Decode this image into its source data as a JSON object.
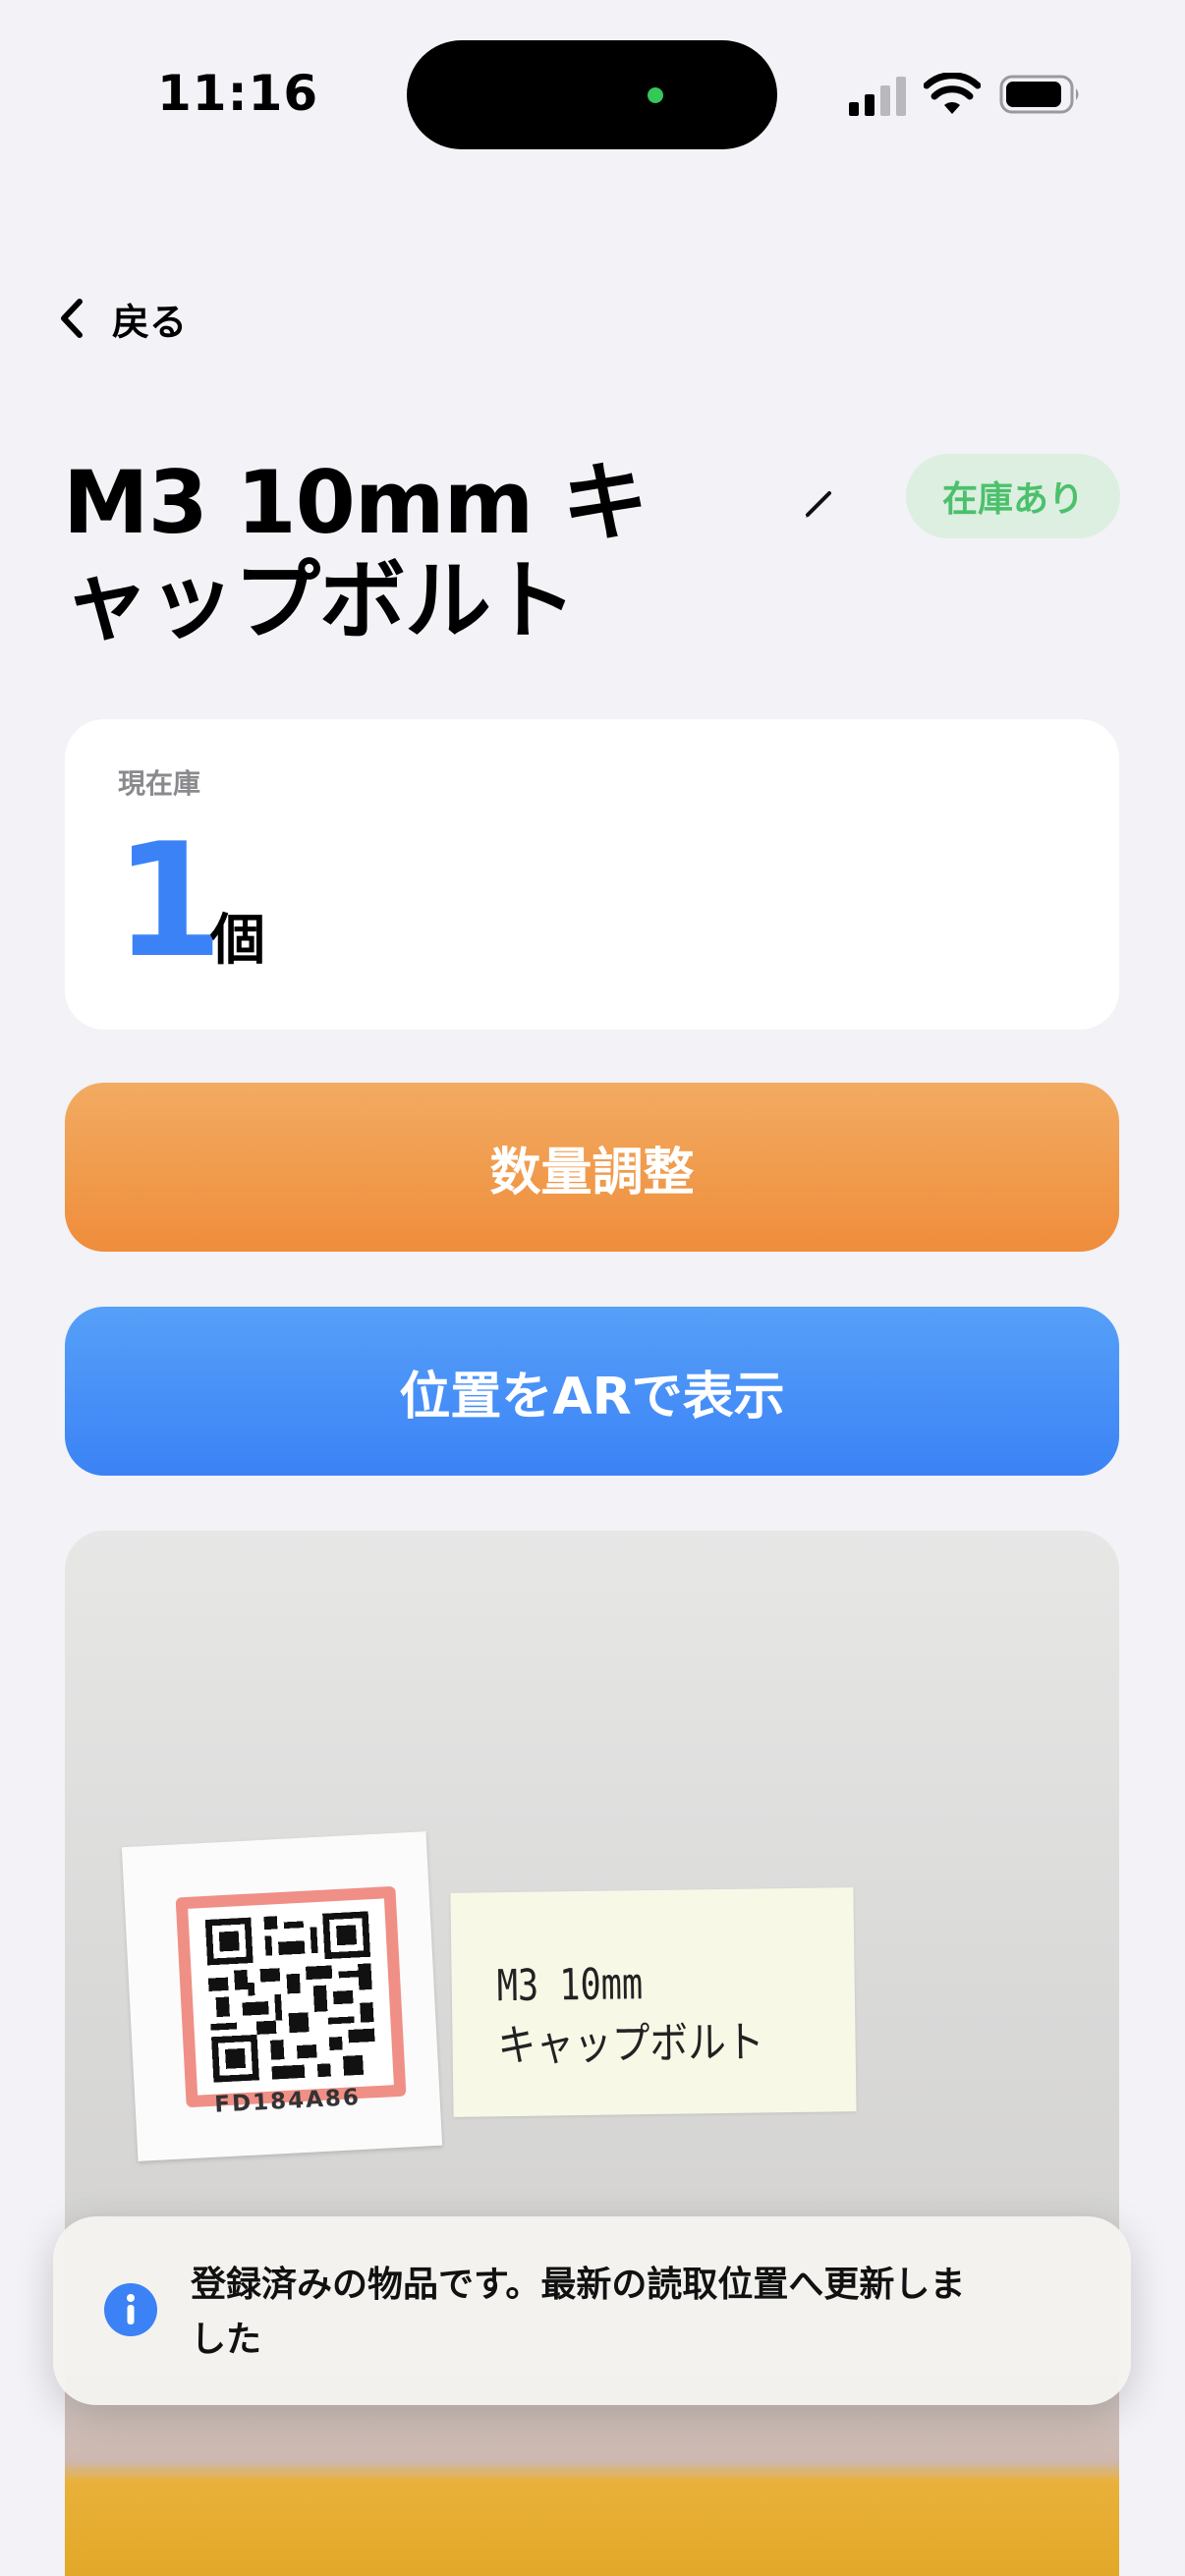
{
  "status_bar": {
    "time": "11:16"
  },
  "nav": {
    "back_label": "戻る"
  },
  "item": {
    "title": "M3 10mm キャップボルト",
    "status_badge": "在庫あり"
  },
  "stock": {
    "label": "現在庫",
    "value": "1",
    "unit": "個"
  },
  "actions": {
    "adjust_label": "数量調整",
    "ar_label": "位置をARで表示"
  },
  "photo": {
    "sticker_code": "FD184A86",
    "label_line1": "M3 10mm",
    "label_line2": "キャップボルト"
  },
  "toast": {
    "message": "登録済みの物品です。最新の読取位置へ更新しました"
  },
  "colors": {
    "accent_blue": "#3b82f6",
    "accent_orange": "#ef8d3b",
    "badge_green": "#4cc06c"
  },
  "icons": [
    "chevron-left-icon",
    "pencil-icon",
    "info-icon",
    "signal-icon",
    "wifi-icon",
    "battery-icon"
  ]
}
